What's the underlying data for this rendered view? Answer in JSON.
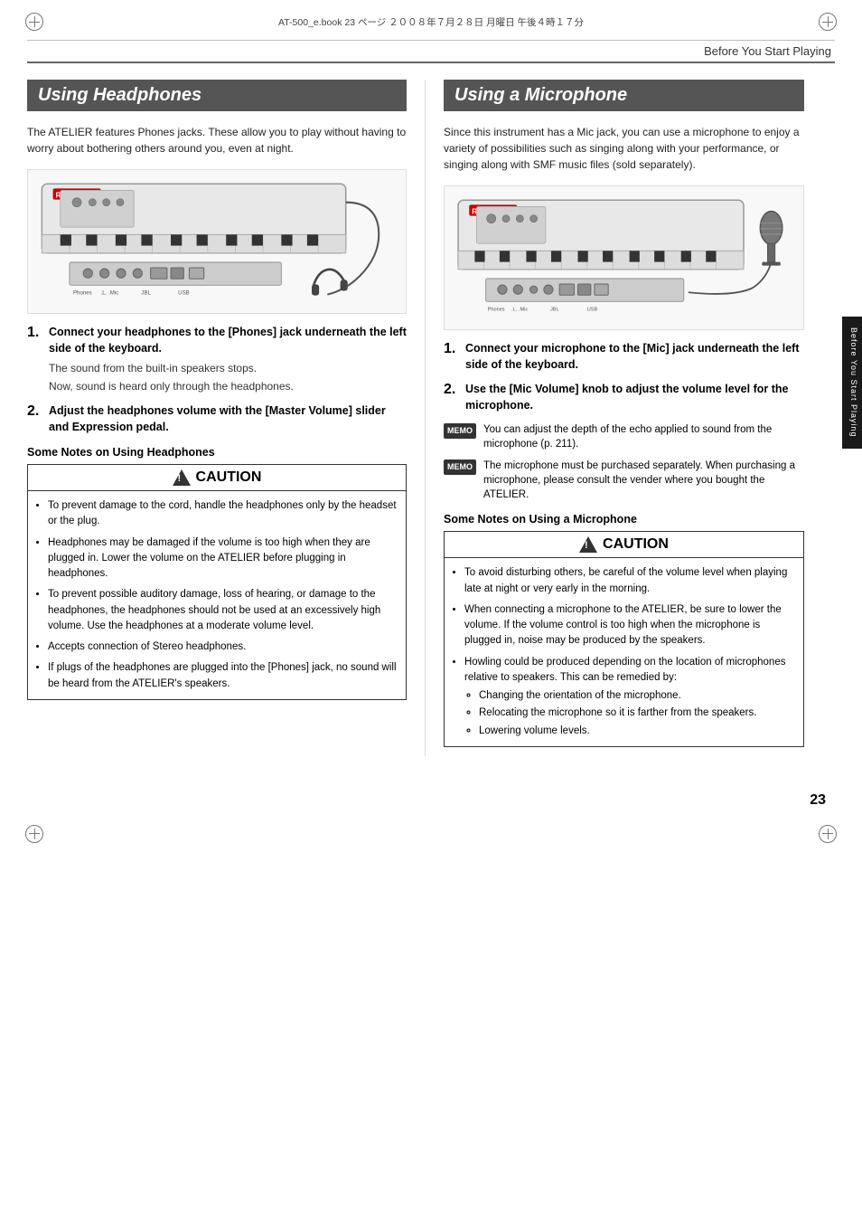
{
  "page": {
    "number": "23",
    "header_title": "Before You Start Playing",
    "side_tab": "Before You Start Playing",
    "file_info": "AT-500_e.book  23 ページ  ２００８年７月２８日   月曜日   午後４時１７分"
  },
  "left_section": {
    "title": "Using Headphones",
    "intro": "The ATELIER features Phones jacks. These allow you to play without having to worry about bothering others around you, even at night.",
    "steps": [
      {
        "num": "1.",
        "main": "Connect your headphones to the [Phones] jack underneath the left side of the keyboard.",
        "details": [
          "The sound from the built-in speakers stops.",
          "Now, sound is heard only through the headphones."
        ]
      },
      {
        "num": "2.",
        "main": "Adjust the headphones volume with the [Master Volume] slider and Expression pedal.",
        "details": []
      }
    ],
    "notes_heading": "Some Notes on Using Headphones",
    "caution_label": "CAUTION",
    "caution_items": [
      "To prevent damage to the cord, handle the headphones only by the headset or the plug.",
      "Headphones may be damaged if the volume is too high when they are plugged in. Lower the volume on the ATELIER before plugging in headphones.",
      "To prevent possible auditory damage, loss of hearing, or damage to the headphones, the headphones should not be used at an excessively high volume. Use the headphones at a moderate volume level.",
      "Accepts connection of Stereo headphones.",
      "If plugs of the headphones are plugged into the [Phones] jack, no sound will be heard from the ATELIER's speakers."
    ]
  },
  "right_section": {
    "title": "Using a Microphone",
    "intro": "Since this instrument has a Mic jack, you can use a microphone to enjoy a variety of possibilities such as singing along with your performance, or singing along with SMF music files (sold separately).",
    "steps": [
      {
        "num": "1.",
        "main": "Connect your microphone to the [Mic] jack underneath the left side of the keyboard.",
        "details": []
      },
      {
        "num": "2.",
        "main": "Use the [Mic Volume] knob to adjust the volume level for the microphone.",
        "details": []
      }
    ],
    "memo_notes": [
      "You can adjust the depth of the echo applied to sound from the microphone (p. 211).",
      "The microphone must be purchased separately. When purchasing a microphone, please consult the vender where you bought the ATELIER."
    ],
    "notes_heading": "Some Notes on Using a Microphone",
    "caution_label": "CAUTION",
    "caution_items": [
      "To avoid disturbing others, be careful of the volume level when playing late at night or very early in the morning.",
      "When connecting a microphone to the ATELIER, be sure to lower the volume. If the volume control is too high when the microphone is plugged in, noise may be produced by the speakers.",
      "Howling could be produced depending on the location of microphones relative to speakers. This can be remedied by:"
    ],
    "caution_sub_items": [
      "Changing the orientation of the microphone.",
      "Relocating the microphone so it is farther from the speakers.",
      "Lowering volume levels."
    ],
    "memo_badge": "MEMO"
  }
}
